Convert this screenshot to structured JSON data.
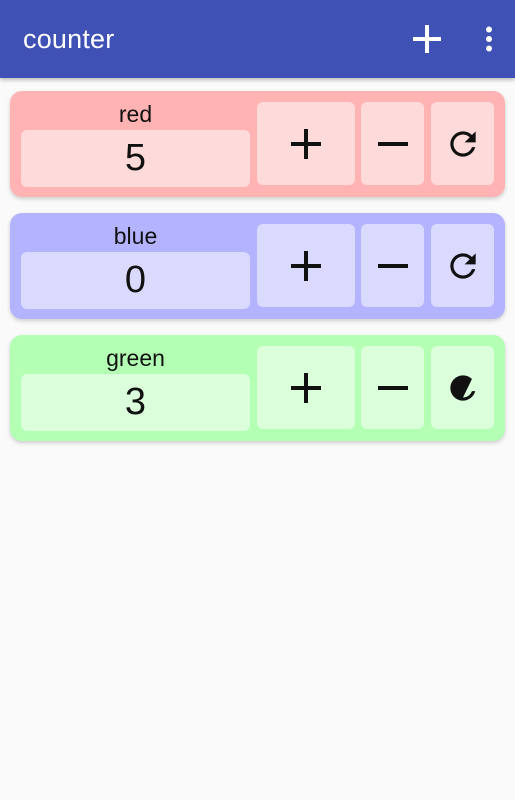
{
  "app": {
    "title": "counter",
    "actions": {
      "add_icon": "plus-icon",
      "menu_icon": "more-vert-icon"
    },
    "colors": {
      "toolbar": "#3f51b5",
      "background": "#fafafa"
    }
  },
  "counters": [
    {
      "name": "red",
      "value": "5",
      "card_color": "#ffb3b3",
      "inner_color": "#ffdada"
    },
    {
      "name": "blue",
      "value": "0",
      "card_color": "#b3b3ff",
      "inner_color": "#dadaff"
    },
    {
      "name": "green",
      "value": "3",
      "card_color": "#b3ffb3",
      "inner_color": "#daffda"
    }
  ],
  "counter_actions": {
    "increment_icon": "plus-icon",
    "decrement_icon": "minus-icon",
    "reset_icon": "refresh-icon"
  }
}
